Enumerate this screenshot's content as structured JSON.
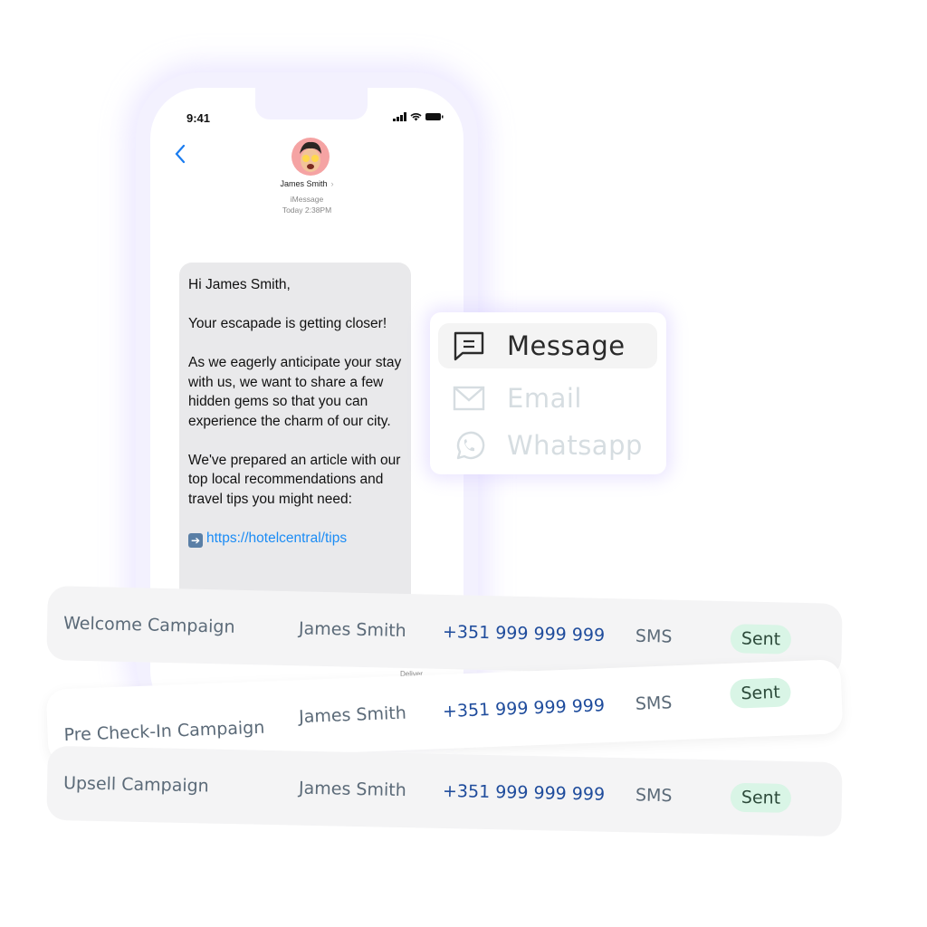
{
  "phone": {
    "status_time": "9:41",
    "contact": {
      "name": "James Smith",
      "service": "iMessage",
      "timestamp": "Today 2:38PM"
    },
    "message": {
      "greeting": "Hi James Smith,",
      "para1": "Your escapade is getting closer!",
      "para2": "As we eagerly anticipate your stay with us, we want to share a few hidden gems so that you can experience the charm of our city.",
      "para3": "We've prepared an article with our top local recommendations and travel tips you might need:",
      "link": "https://hotelcentral/tips"
    },
    "delivered_label": "Deliver..."
  },
  "channel_menu": {
    "items": [
      {
        "label": "Message",
        "icon": "message-icon",
        "active": true
      },
      {
        "label": "Email",
        "icon": "email-icon",
        "active": false
      },
      {
        "label": "Whatsapp",
        "icon": "whatsapp-icon",
        "active": false
      }
    ]
  },
  "campaigns": [
    {
      "name": "Welcome Campaign",
      "guest": "James Smith",
      "phone": "+351 999 999 999",
      "channel": "SMS",
      "status": "Sent"
    },
    {
      "name": "Pre Check-In Campaign",
      "guest": "James Smith",
      "phone": "+351 999 999 999",
      "channel": "SMS",
      "status": "Sent"
    },
    {
      "name": "Upsell Campaign",
      "guest": "James Smith",
      "phone": "+351 999 999 999",
      "channel": "SMS",
      "status": "Sent"
    }
  ],
  "colors": {
    "accent_blue": "#1a7cf0",
    "phone_number": "#1f4c9c",
    "sent_badge_bg": "#d9f5e6"
  }
}
